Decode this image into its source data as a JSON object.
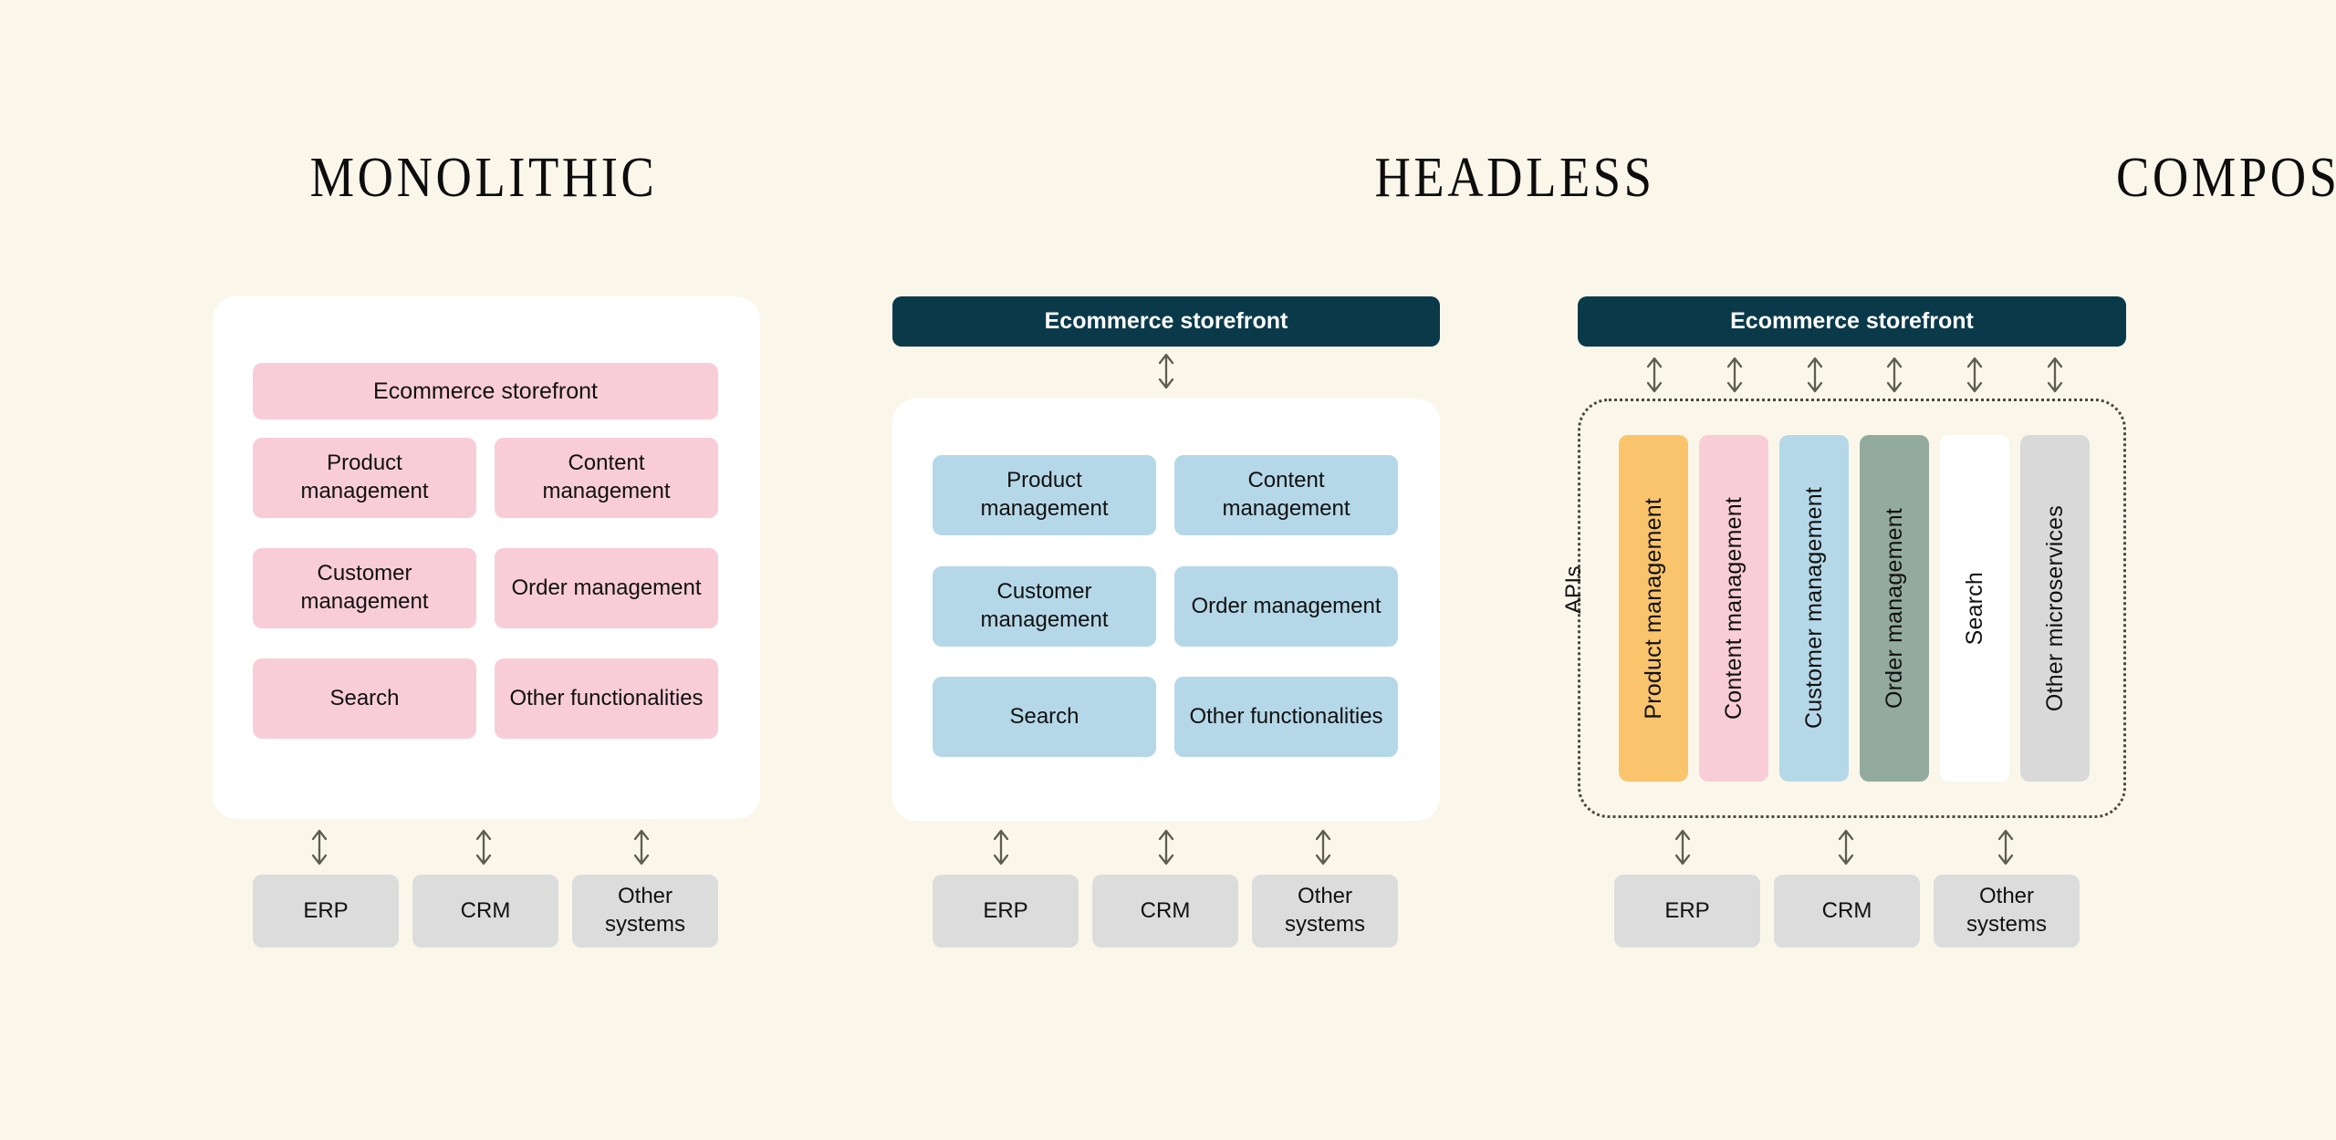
{
  "background_color": "#faf7ea",
  "columns": [
    {
      "id": "monolithic",
      "title": "MONOLITHIC",
      "storefront": {
        "label": "Ecommerce storefront",
        "style": "pink"
      },
      "modules": [
        "Product management",
        "Content management",
        "Customer management",
        "Order management",
        "Search",
        "Other functionalities"
      ],
      "module_color": "#f9cdd8",
      "systems": [
        "ERP",
        "CRM",
        "Other systems"
      ],
      "system_color": "#dcdcdc",
      "connector_count": 3
    },
    {
      "id": "headless",
      "title": "HEADLESS",
      "storefront": {
        "label": "Ecommerce storefront",
        "style": "dark"
      },
      "storefront_color": "#0a3a4a",
      "modules": [
        "Product management",
        "Content management",
        "Customer management",
        "Order management",
        "Search",
        "Other functionalities"
      ],
      "module_color": "#b5d8e8",
      "systems": [
        "ERP",
        "CRM",
        "Other systems"
      ],
      "system_color": "#dcdcdc",
      "top_connector_count": 1,
      "connector_count": 3
    },
    {
      "id": "composable",
      "title": "COMPOSABLE",
      "storefront": {
        "label": "Ecommerce storefront",
        "style": "dark"
      },
      "storefront_color": "#0a3a4a",
      "api_label": "APIs",
      "services": [
        {
          "label": "Product management",
          "color": "#f9c46b"
        },
        {
          "label": "Content management",
          "color": "#f9cdd8"
        },
        {
          "label": "Customer management",
          "color": "#b5d8e8"
        },
        {
          "label": "Order management",
          "color": "#93ab9f"
        },
        {
          "label": "Search",
          "color": "#ffffff"
        },
        {
          "label": "Other microservices",
          "color": "#d9d9d9"
        }
      ],
      "systems": [
        "ERP",
        "CRM",
        "Other systems"
      ],
      "system_color": "#dcdcdc",
      "top_connector_count": 6,
      "connector_count": 3
    }
  ],
  "icons": {
    "connector": "double-headed-vertical-arrow"
  }
}
